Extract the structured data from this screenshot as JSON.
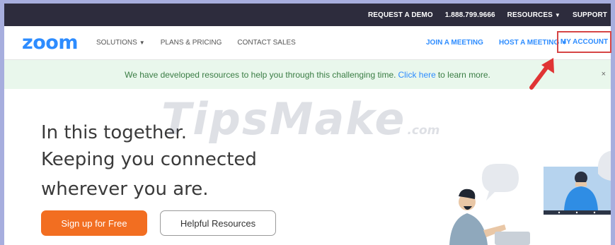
{
  "topbar": {
    "request_demo": "REQUEST A DEMO",
    "phone": "1.888.799.9666",
    "resources": "RESOURCES",
    "support": "SUPPORT"
  },
  "nav": {
    "logo": "zoom",
    "solutions": "SOLUTIONS",
    "plans_pricing": "PLANS & PRICING",
    "contact_sales": "CONTACT SALES",
    "join_meeting": "JOIN A MEETING",
    "host_meeting": "HOST A MEETING",
    "my_account": "MY ACCOUNT"
  },
  "banner": {
    "text_before": "We have developed resources to help you through this challenging time.",
    "link": "Click here",
    "text_after": "to learn more.",
    "close": "×"
  },
  "hero": {
    "line1": "In this together.",
    "line2": "Keeping you connected",
    "line3": "wherever you are.",
    "signup_button": "Sign up for Free",
    "resources_button": "Helpful Resources"
  },
  "watermark": {
    "main": "TipsMake",
    "suffix": ".com"
  },
  "colors": {
    "topbar_bg": "#2d2c3d",
    "brand_blue": "#2d8cff",
    "cta_orange": "#f26e21",
    "banner_bg": "#e9f7ec",
    "highlight_red": "#d64545"
  },
  "icons": {
    "dropdown": "chevron-down-icon",
    "close": "close-icon",
    "annotation": "red-arrow-icon"
  }
}
